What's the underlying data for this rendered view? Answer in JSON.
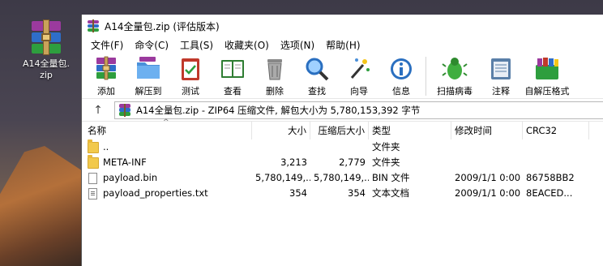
{
  "desktop": {
    "icon_label_line1": "A14全量包.",
    "icon_label_line2": "zip"
  },
  "window": {
    "title": "A14全量包.zip (评估版本)"
  },
  "menu": [
    "文件(F)",
    "命令(C)",
    "工具(S)",
    "收藏夹(O)",
    "选项(N)",
    "帮助(H)"
  ],
  "toolbar": {
    "add": "添加",
    "extract_to": "解压到",
    "test": "测试",
    "view": "查看",
    "delete": "删除",
    "find": "查找",
    "wizard": "向导",
    "info": "信息",
    "virus_scan": "扫描病毒",
    "comment": "注释",
    "sfx": "自解压格式"
  },
  "address": {
    "up_icon": "↑",
    "text": "A14全量包.zip - ZIP64 压缩文件, 解包大小为 5,780,153,392 字节"
  },
  "columns": {
    "name": "名称",
    "size": "大小",
    "packed": "压缩后大小",
    "type": "类型",
    "modified": "修改时间",
    "crc": "CRC32",
    "sort_arrow": "^"
  },
  "files": [
    {
      "name": "..",
      "size": "",
      "packed": "",
      "type": "文件夹",
      "modified": "",
      "crc": "",
      "icon": "folder-icon"
    },
    {
      "name": "META-INF",
      "size": "3,213",
      "packed": "2,779",
      "type": "文件夹",
      "modified": "",
      "crc": "",
      "icon": "folder-icon"
    },
    {
      "name": "payload.bin",
      "size": "5,780,149,...",
      "packed": "5,780,149,...",
      "type": "BIN 文件",
      "modified": "2009/1/1 0:00",
      "crc": "86758BB2",
      "icon": "file-icon"
    },
    {
      "name": "payload_properties.txt",
      "size": "354",
      "packed": "354",
      "type": "文本文档",
      "modified": "2009/1/1 0:00",
      "crc": "8EACED...",
      "icon": "text-file-icon"
    }
  ]
}
